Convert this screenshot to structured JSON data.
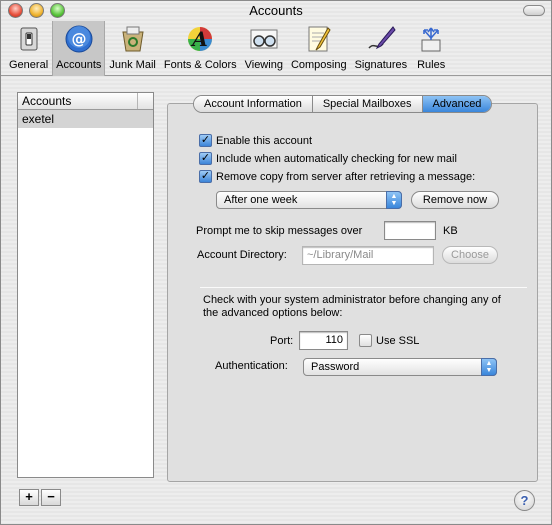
{
  "window": {
    "title": "Accounts"
  },
  "toolbar": {
    "items": [
      {
        "label": "General",
        "icon": "switch-icon"
      },
      {
        "label": "Accounts",
        "icon": "at-sign-icon"
      },
      {
        "label": "Junk Mail",
        "icon": "recycle-icon"
      },
      {
        "label": "Fonts & Colors",
        "icon": "letter-a-icon"
      },
      {
        "label": "Viewing",
        "icon": "glasses-icon"
      },
      {
        "label": "Composing",
        "icon": "pencil-paper-icon"
      },
      {
        "label": "Signatures",
        "icon": "pen-icon"
      },
      {
        "label": "Rules",
        "icon": "rules-arrows-icon"
      }
    ],
    "selected": "Accounts"
  },
  "accounts": {
    "header": "Accounts",
    "items": [
      "exetel"
    ],
    "add_label": "+",
    "remove_label": "−"
  },
  "tabs": {
    "items": [
      "Account Information",
      "Special Mailboxes",
      "Advanced"
    ],
    "active": "Advanced"
  },
  "advanced": {
    "enable_label": "Enable this account",
    "include_label": "Include when automatically checking for new mail",
    "remove_copy_label": "Remove copy from server after retrieving a message:",
    "remove_after_value": "After one week",
    "remove_now_label": "Remove now",
    "prompt_label": "Prompt me to skip messages over",
    "prompt_value": "",
    "kb_label": "KB",
    "account_dir_label": "Account Directory:",
    "account_dir_value": "~/Library/Mail",
    "choose_label": "Choose",
    "admin_note": "Check with your system administrator before changing any of the advanced options below:",
    "port_label": "Port:",
    "port_value": "110",
    "ssl_label": "Use SSL",
    "auth_label": "Authentication:",
    "auth_value": "Password"
  },
  "help": {
    "label": "?"
  },
  "colors": {
    "accent": "#3a86db",
    "selected_row": "#d4d4d4"
  }
}
